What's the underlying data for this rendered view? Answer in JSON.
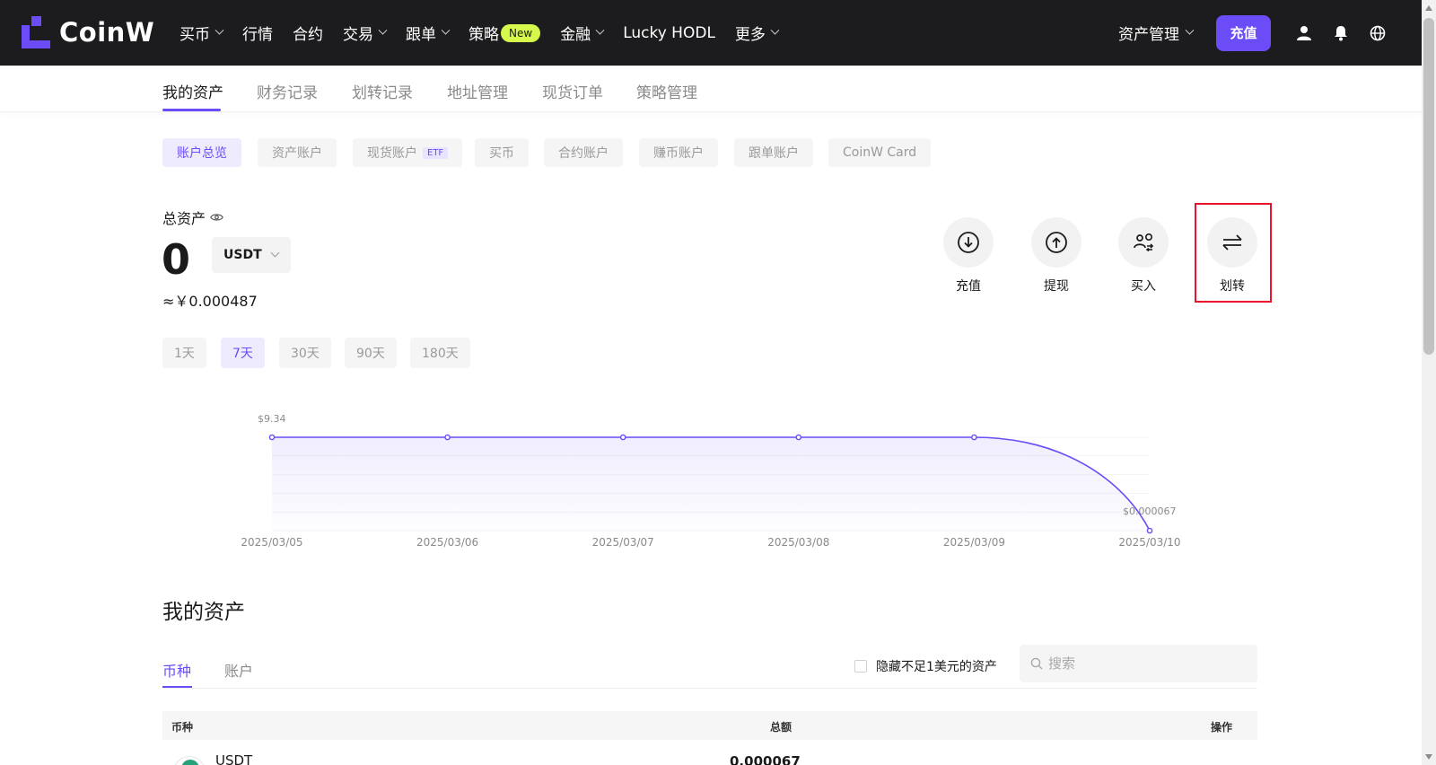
{
  "brand": {
    "name": "CoinW"
  },
  "nav": {
    "items": [
      {
        "label": "买币",
        "dropdown": true
      },
      {
        "label": "行情",
        "dropdown": false
      },
      {
        "label": "合约",
        "dropdown": false
      },
      {
        "label": "交易",
        "dropdown": true
      },
      {
        "label": "跟单",
        "dropdown": true
      },
      {
        "label": "策略",
        "dropdown": false
      },
      {
        "label": "金融",
        "dropdown": true
      },
      {
        "label": "Lucky HODL",
        "dropdown": false
      },
      {
        "label": "更多",
        "dropdown": true
      }
    ],
    "strategy_badge": "New",
    "asset_management": "资产管理",
    "deposit_button": "充值"
  },
  "subtabs": [
    "我的资产",
    "财务记录",
    "划转记录",
    "地址管理",
    "现货订单",
    "策略管理"
  ],
  "chips": [
    "账户总览",
    "资产账户",
    "现货账户",
    "买币",
    "合约账户",
    "赚币账户",
    "跟单账户",
    "CoinW Card"
  ],
  "etf_tag": "ETF",
  "total": {
    "label": "总资产",
    "value": "0",
    "currency": "USDT",
    "approx": "≈￥0.000487"
  },
  "actions": [
    "充值",
    "提现",
    "买入",
    "划转"
  ],
  "ranges": [
    "1天",
    "7天",
    "30天",
    "90天",
    "180天"
  ],
  "colors": {
    "accent": "#6b4cf6",
    "highlight": "#e8132b",
    "nav_bg": "#1c1c1e",
    "badge": "#d6f84a"
  },
  "chart_data": {
    "type": "area",
    "x": [
      "2025/03/05",
      "2025/03/06",
      "2025/03/07",
      "2025/03/08",
      "2025/03/09",
      "2025/03/10"
    ],
    "values": [
      9.34,
      9.34,
      9.34,
      9.34,
      9.34,
      6.7e-05
    ],
    "max_label": "$9.34",
    "min_label": "$0.000067",
    "ylim": [
      0,
      9.34
    ]
  },
  "my_assets": {
    "title": "我的资产",
    "tabs": [
      "币种",
      "账户"
    ],
    "hide_small_label": "隐藏不足1美元的资产",
    "search_placeholder": "搜索",
    "table": {
      "headers": [
        "币种",
        "总额",
        "操作"
      ],
      "rows": [
        {
          "coin": "USDT",
          "total": "0.000067"
        }
      ]
    }
  }
}
